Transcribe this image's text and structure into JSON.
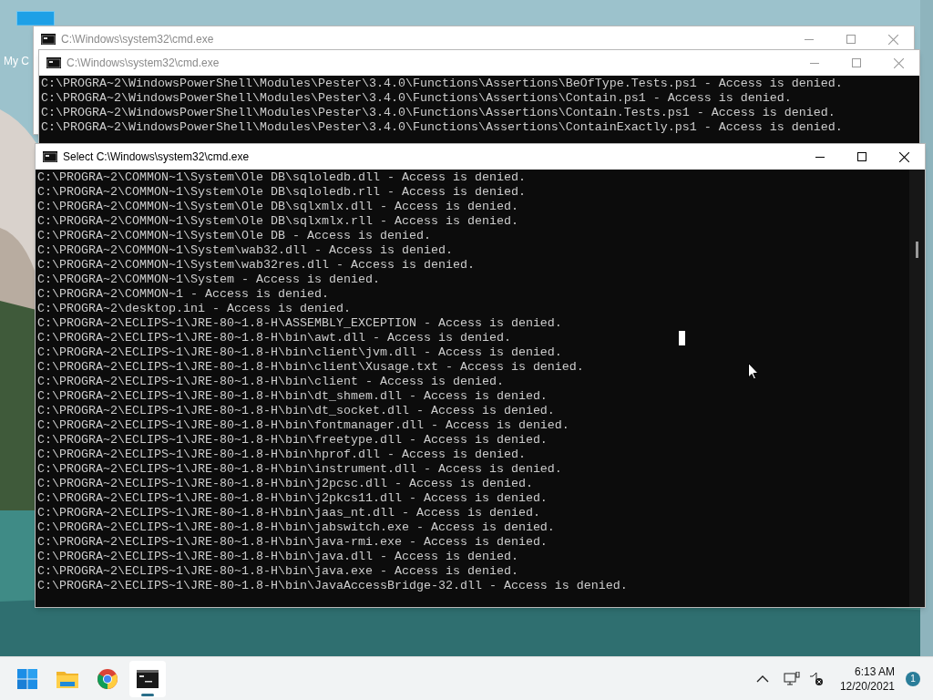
{
  "desktop": {
    "icons": [
      {
        "label": "My C"
      }
    ]
  },
  "windows": [
    {
      "title": "C:\\Windows\\system32\\cmd.exe",
      "active": false
    },
    {
      "title": "C:\\Windows\\system32\\cmd.exe",
      "active": false,
      "lines": [
        "C:\\PROGRA~2\\WindowsPowerShell\\Modules\\Pester\\3.4.0\\Functions\\Assertions\\BeOfType.Tests.ps1 - Access is denied.",
        "C:\\PROGRA~2\\WindowsPowerShell\\Modules\\Pester\\3.4.0\\Functions\\Assertions\\Contain.ps1 - Access is denied.",
        "C:\\PROGRA~2\\WindowsPowerShell\\Modules\\Pester\\3.4.0\\Functions\\Assertions\\Contain.Tests.ps1 - Access is denied.",
        "C:\\PROGRA~2\\WindowsPowerShell\\Modules\\Pester\\3.4.0\\Functions\\Assertions\\ContainExactly.ps1 - Access is denied."
      ]
    },
    {
      "title": "Select C:\\Windows\\system32\\cmd.exe",
      "active": true,
      "lines": [
        "C:\\PROGRA~2\\COMMON~1\\System\\Ole DB\\sqloledb.dll - Access is denied.",
        "C:\\PROGRA~2\\COMMON~1\\System\\Ole DB\\sqloledb.rll - Access is denied.",
        "C:\\PROGRA~2\\COMMON~1\\System\\Ole DB\\sqlxmlx.dll - Access is denied.",
        "C:\\PROGRA~2\\COMMON~1\\System\\Ole DB\\sqlxmlx.rll - Access is denied.",
        "C:\\PROGRA~2\\COMMON~1\\System\\Ole DB - Access is denied.",
        "C:\\PROGRA~2\\COMMON~1\\System\\wab32.dll - Access is denied.",
        "C:\\PROGRA~2\\COMMON~1\\System\\wab32res.dll - Access is denied.",
        "C:\\PROGRA~2\\COMMON~1\\System - Access is denied.",
        "C:\\PROGRA~2\\COMMON~1 - Access is denied.",
        "C:\\PROGRA~2\\desktop.ini - Access is denied.",
        "C:\\PROGRA~2\\ECLIPS~1\\JRE-80~1.8-H\\ASSEMBLY_EXCEPTION - Access is denied.",
        "C:\\PROGRA~2\\ECLIPS~1\\JRE-80~1.8-H\\bin\\awt.dll - Access is denied.",
        "C:\\PROGRA~2\\ECLIPS~1\\JRE-80~1.8-H\\bin\\client\\jvm.dll - Access is denied.",
        "C:\\PROGRA~2\\ECLIPS~1\\JRE-80~1.8-H\\bin\\client\\Xusage.txt - Access is denied.",
        "C:\\PROGRA~2\\ECLIPS~1\\JRE-80~1.8-H\\bin\\client - Access is denied.",
        "C:\\PROGRA~2\\ECLIPS~1\\JRE-80~1.8-H\\bin\\dt_shmem.dll - Access is denied.",
        "C:\\PROGRA~2\\ECLIPS~1\\JRE-80~1.8-H\\bin\\dt_socket.dll - Access is denied.",
        "C:\\PROGRA~2\\ECLIPS~1\\JRE-80~1.8-H\\bin\\fontmanager.dll - Access is denied.",
        "C:\\PROGRA~2\\ECLIPS~1\\JRE-80~1.8-H\\bin\\freetype.dll - Access is denied.",
        "C:\\PROGRA~2\\ECLIPS~1\\JRE-80~1.8-H\\bin\\hprof.dll - Access is denied.",
        "C:\\PROGRA~2\\ECLIPS~1\\JRE-80~1.8-H\\bin\\instrument.dll - Access is denied.",
        "C:\\PROGRA~2\\ECLIPS~1\\JRE-80~1.8-H\\bin\\j2pcsc.dll - Access is denied.",
        "C:\\PROGRA~2\\ECLIPS~1\\JRE-80~1.8-H\\bin\\j2pkcs11.dll - Access is denied.",
        "C:\\PROGRA~2\\ECLIPS~1\\JRE-80~1.8-H\\bin\\jaas_nt.dll - Access is denied.",
        "C:\\PROGRA~2\\ECLIPS~1\\JRE-80~1.8-H\\bin\\jabswitch.exe - Access is denied.",
        "C:\\PROGRA~2\\ECLIPS~1\\JRE-80~1.8-H\\bin\\java-rmi.exe - Access is denied.",
        "C:\\PROGRA~2\\ECLIPS~1\\JRE-80~1.8-H\\bin\\java.dll - Access is denied.",
        "C:\\PROGRA~2\\ECLIPS~1\\JRE-80~1.8-H\\bin\\java.exe - Access is denied.",
        "C:\\PROGRA~2\\ECLIPS~1\\JRE-80~1.8-H\\bin\\JavaAccessBridge-32.dll - Access is denied."
      ]
    }
  ],
  "taskbar": {
    "apps": [
      {
        "kind": "start",
        "selected": false
      },
      {
        "kind": "folder",
        "selected": false
      },
      {
        "kind": "browser",
        "selected": false
      },
      {
        "kind": "terminal",
        "selected": true
      }
    ],
    "time": "6:13 AM",
    "date": "12/20/2021",
    "notifications": "1"
  }
}
